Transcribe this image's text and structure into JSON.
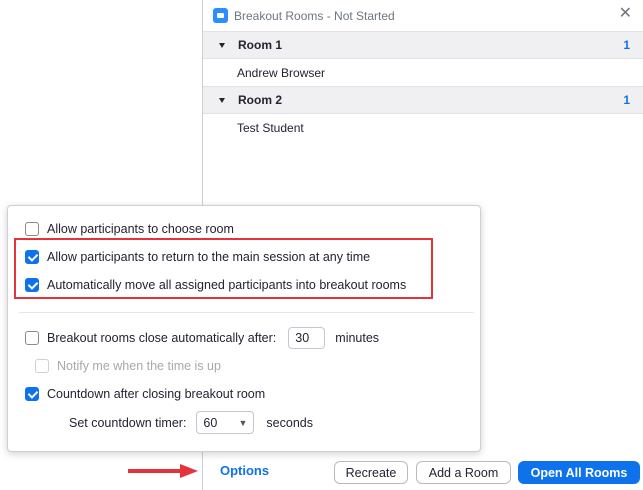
{
  "window": {
    "title": "Breakout Rooms - Not Started",
    "close_glyph": "✕"
  },
  "rooms": [
    {
      "name": "Room 1",
      "count": "1",
      "participants": [
        "Andrew Browser"
      ]
    },
    {
      "name": "Room 2",
      "count": "1",
      "participants": [
        "Test Student"
      ]
    }
  ],
  "options": {
    "allow_choose": {
      "label": "Allow participants to choose room",
      "checked": false
    },
    "allow_return": {
      "label": "Allow participants to return to the main session at any time",
      "checked": true
    },
    "auto_move": {
      "label": "Automatically move all assigned participants into breakout rooms",
      "checked": true
    },
    "auto_close": {
      "label_before": "Breakout rooms close automatically after:",
      "value": "30",
      "label_after": "minutes",
      "checked": false
    },
    "notify": {
      "label": "Notify me when the time is up",
      "checked": false,
      "disabled": true
    },
    "countdown": {
      "label": "Countdown after closing breakout room",
      "checked": true
    },
    "countdown_timer": {
      "label": "Set countdown timer:",
      "value": "60",
      "unit": "seconds"
    }
  },
  "footer": {
    "options_link": "Options",
    "recreate": "Recreate",
    "add_room": "Add a Room",
    "open_all": "Open All Rooms"
  },
  "colors": {
    "accent": "#0e72ed",
    "highlight": "#e5333c"
  },
  "icons": {
    "app": "zoom-camera-icon",
    "close": "close-icon",
    "caret": "caret-down-icon",
    "arrow": "arrow-right-icon",
    "chevron": "chevron-down-icon"
  }
}
